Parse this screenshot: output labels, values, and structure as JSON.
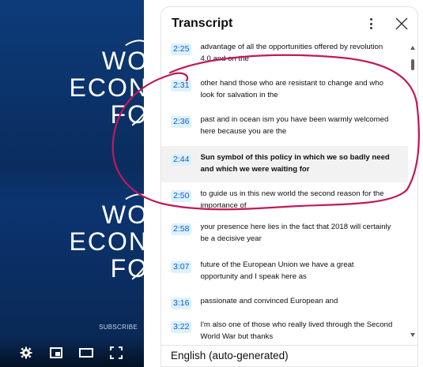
{
  "video": {
    "logo_lines_top": [
      "WO",
      "ECON",
      "FO"
    ],
    "logo_lines_bottom": [
      "WO",
      "ECON",
      "FO"
    ],
    "subscribe_label": "SUBSCRIBE",
    "controls": [
      "settings-icon",
      "miniplayer-icon",
      "theater-mode-icon",
      "fullscreen-icon"
    ]
  },
  "transcript": {
    "title": "Transcript",
    "segments": [
      {
        "time": "2:25",
        "text": "advantage of all the opportunities offered by revolution 4.0 and on the",
        "active": false
      },
      {
        "time": "2:31",
        "text": "other hand those who are resistant to change and who look for salvation in the",
        "active": false
      },
      {
        "time": "2:36",
        "text": "past and in ocean ism you have been warmly welcomed here because you are the",
        "active": false
      },
      {
        "time": "2:44",
        "text": "Sun symbol of this policy in which we so badly need and which we were waiting for",
        "active": true
      },
      {
        "time": "2:50",
        "text": "to guide us in this new world the second reason for the importance of",
        "active": false
      },
      {
        "time": "2:58",
        "text": "your presence here lies in the fact that 2018 will certainly be a decisive year",
        "active": false
      },
      {
        "time": "3:07",
        "text": "future of the European Union we have a great opportunity and I speak here as",
        "active": false
      },
      {
        "time": "3:16",
        "text": "passionate and convinced European and",
        "active": false
      },
      {
        "time": "3:22",
        "text": "I'm also one of those who really lived through the Second World War but thanks",
        "active": false
      }
    ],
    "footer_language": "English (auto-generated)"
  },
  "colors": {
    "video_bg": "#0b2e63",
    "timestamp_bg": "#def1ff",
    "timestamp_text": "#065fd4",
    "active_row_bg": "#f2f2f2",
    "annotation_stroke": "#c2185b"
  }
}
